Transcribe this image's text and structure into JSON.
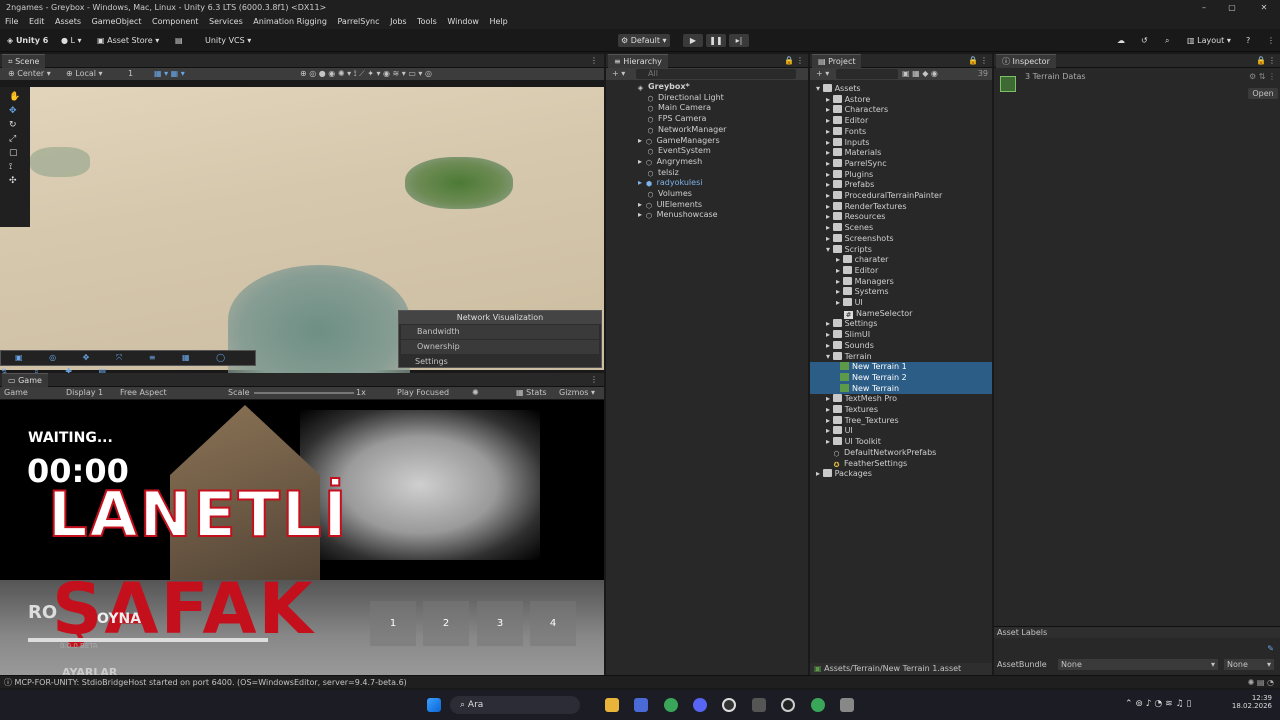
{
  "window": {
    "title": "2ngames - Greybox - Windows, Mac, Linux - Unity 6.3 LTS (6000.3.8f1) <DX11>",
    "minimize": "–",
    "maximize": "▢",
    "close": "✕"
  },
  "menu": [
    "File",
    "Edit",
    "Assets",
    "GameObject",
    "Component",
    "Services",
    "Animation Rigging",
    "ParrelSync",
    "Jobs",
    "Tools",
    "Window",
    "Help"
  ],
  "toolbar": {
    "unity": "Unity 6",
    "account": "L",
    "asset_store": "Asset Store",
    "vcs": "Unity VCS",
    "play_mode": "Default",
    "layout": "Layout"
  },
  "scene": {
    "tab": "Scene",
    "pivot": "Center",
    "space": "Local",
    "snap": "1",
    "netvis": {
      "title": "Network Visualization",
      "items": [
        "Bandwidth",
        "Ownership",
        "Settings"
      ]
    }
  },
  "game": {
    "tab": "Game",
    "mode": "Game",
    "display": "Display 1",
    "aspect": "Free Aspect",
    "scale_label": "Scale",
    "scale_value": "1x",
    "focus": "Play Focused",
    "stats": "Stats",
    "gizmos": "Gizmos",
    "waiting": "WAITING...",
    "timer": "00:00",
    "title1": "LANETLİ",
    "title2": "ŞAFAK",
    "rol": "RO",
    "oyna": "OYNA",
    "version": "0.0.0 BETA",
    "ayarlar": "AYARLAR",
    "buttons": [
      "1",
      "2",
      "3",
      "4"
    ]
  },
  "hierarchy": {
    "tab": "Hierarchy",
    "search_placeholder": "All",
    "root": "Greybox*",
    "items": [
      "Directional Light",
      "Main Camera",
      "FPS Camera",
      "NetworkManager",
      "GameManagers",
      "EventSystem",
      "Angrymesh",
      "telsiz",
      "radyokulesi",
      "Volumes",
      "UIElements",
      "Menushowcase"
    ]
  },
  "project": {
    "tab": "Project",
    "count": "39",
    "assets": "Assets",
    "folders": [
      "Astore",
      "Characters",
      "Editor",
      "Fonts",
      "Inputs",
      "Materials",
      "ParrelSync",
      "Plugins",
      "Prefabs",
      "ProceduralTerrainPainter",
      "RenderTextures",
      "Resources",
      "Scenes",
      "Screenshots",
      "Scripts"
    ],
    "scripts_children": [
      "charater",
      "Editor",
      "Managers",
      "Systems",
      "UI",
      "NameSelector"
    ],
    "folders2": [
      "Settings",
      "SlimUI",
      "Sounds",
      "Terrain"
    ],
    "terrain_children": [
      "New Terrain 1",
      "New Terrain 2",
      "New Terrain"
    ],
    "folders3": [
      "TextMesh Pro",
      "Textures",
      "Tree_Textures",
      "UI",
      "UI Toolkit",
      "DefaultNetworkPrefabs",
      "FeatherSettings"
    ],
    "packages": "Packages",
    "path": "Assets/Terrain/New Terrain 1.asset"
  },
  "inspector": {
    "tab": "Inspector",
    "title": "3 Terrain Datas",
    "open": "Open",
    "labels": "Asset Labels",
    "bundle_label": "AssetBundle",
    "bundle_value": "None",
    "variant_value": "None"
  },
  "status": {
    "text": "MCP-FOR-UNITY: StdioBridgeHost started on port 6400. (OS=WindowsEditor, server=9.4.7-beta.6)"
  },
  "taskbar": {
    "search": "Ara",
    "time": "12:39",
    "date": "18.02.2026"
  },
  "colors": {
    "selection": "#2c5d87",
    "title_red": "#c4101c",
    "accent": "#4a90d9"
  }
}
